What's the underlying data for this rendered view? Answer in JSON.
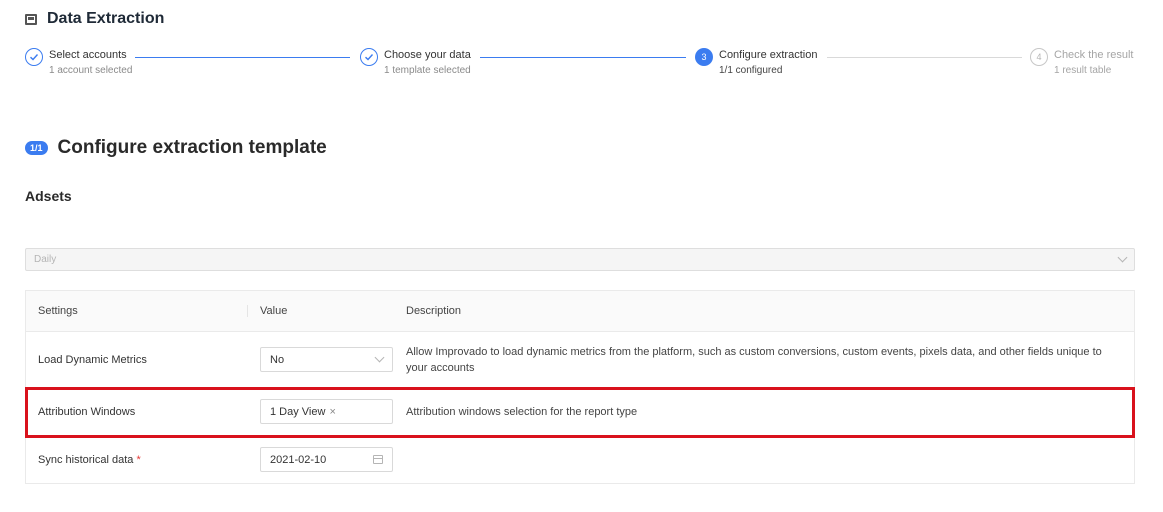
{
  "header": {
    "icon": "app-window-icon",
    "title": "Data Extraction"
  },
  "steps": [
    {
      "label": "Select accounts",
      "sub": "1 account selected",
      "state": "done",
      "icon": "check-icon"
    },
    {
      "label": "Choose your data",
      "sub": "1 template selected",
      "state": "done",
      "icon": "check-icon"
    },
    {
      "label": "Configure extraction",
      "sub": "1/1 configured",
      "state": "active",
      "number": "3"
    },
    {
      "label": "Check the result",
      "sub": "1 result table",
      "state": "todo",
      "number": "4"
    }
  ],
  "section": {
    "badge": "1/1",
    "title": "Configure extraction template"
  },
  "group": {
    "title": "Adsets"
  },
  "granularity": {
    "value": "Daily"
  },
  "table": {
    "headers": {
      "settings": "Settings",
      "value": "Value",
      "description": "Description"
    },
    "rows": [
      {
        "setting": "Load Dynamic Metrics",
        "value": "No",
        "description": "Allow Improvado to load dynamic metrics from the platform, such as custom conversions, custom events, pixels data, and other fields unique to your accounts"
      },
      {
        "setting": "Attribution Windows",
        "value": "1 Day View",
        "remove": "×",
        "description": "Attribution windows selection for the report type"
      },
      {
        "setting": "Sync historical data",
        "required": "*",
        "value": "2021-02-10",
        "description": ""
      }
    ]
  },
  "colors": {
    "accent": "#3b7cf0",
    "highlight": "#d9121c"
  }
}
